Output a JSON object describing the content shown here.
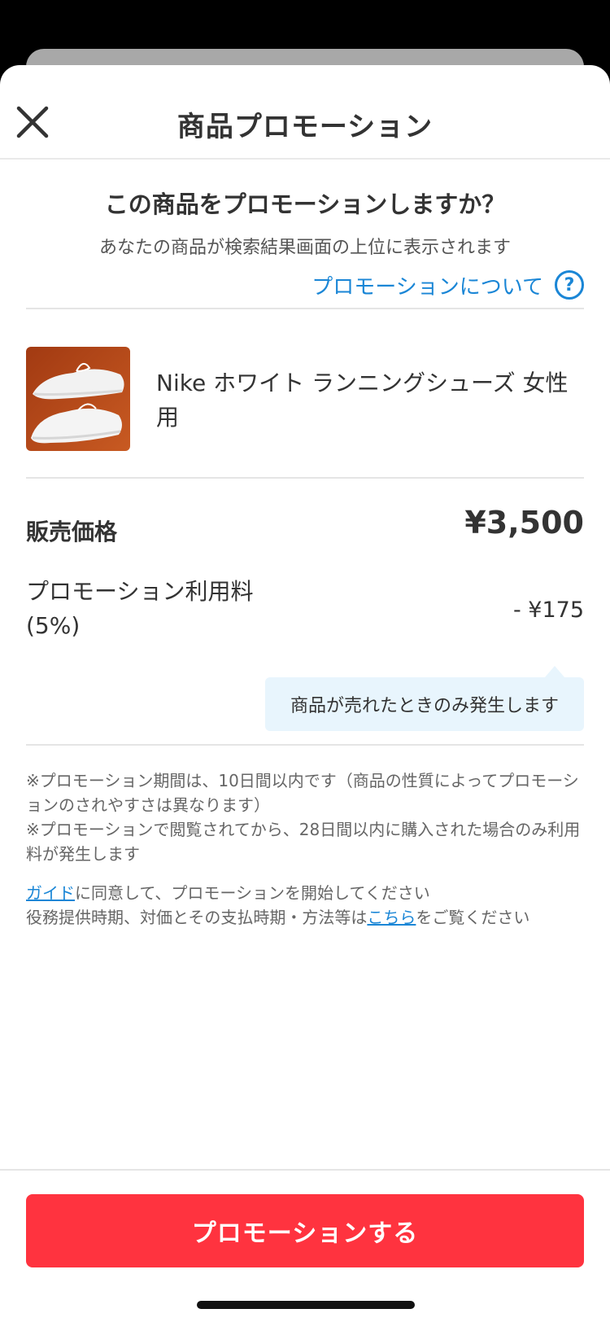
{
  "header": {
    "title": "商品プロモーション",
    "close_icon": "close-icon"
  },
  "intro": {
    "question": "この商品をプロモーションしますか？",
    "subtitle": "あなたの商品が検索結果画面の上位に表示されます",
    "about_link": "プロモーションについて",
    "help_icon_glyph": "?"
  },
  "product": {
    "name": "Nike ホワイト ランニングシューズ 女性用",
    "thumbnail": "white-sneakers-photo"
  },
  "pricing": {
    "price_label": "販売価格",
    "price_value": "¥3,500",
    "fee_label_line1": "プロモーション利用料",
    "fee_label_line2": "(5%)",
    "fee_value": "- ¥175",
    "tooltip": "商品が売れたときのみ発生します"
  },
  "notes": {
    "note1": "※プロモーション期間は、10日間以内です（商品の性質によってプロモーションのされやすさは異なります）",
    "note2": "※プロモーションで閲覧されてから、28日間以内に購入された場合のみ利用料が発生します"
  },
  "agreement": {
    "guide_link": "ガイド",
    "line1_rest": "に同意して、プロモーションを開始してください",
    "line2_prefix": "役務提供時期、対価とその支払時期・方法等は",
    "here_link": "こちら",
    "line2_suffix": "をご覧ください"
  },
  "cta": {
    "label": "プロモーションする"
  },
  "colors": {
    "accent_red": "#ff333f",
    "link_blue": "#1a86d6",
    "tooltip_bg": "#e8f5fd"
  }
}
